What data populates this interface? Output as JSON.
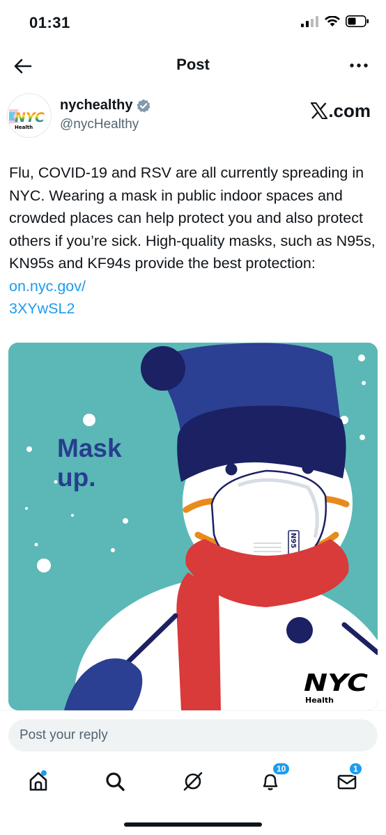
{
  "status": {
    "time": "01:31"
  },
  "nav": {
    "title": "Post"
  },
  "author": {
    "display_name": "nychealthy",
    "handle": "@nycHealthy",
    "source": ".com",
    "avatar_text": "NYC",
    "avatar_sub": "Health"
  },
  "post": {
    "text": "Flu, COVID-19 and RSV are all currently spreading in NYC. Wearing a mask in public indoor spaces and crowded places can help protect you and also protect others if you’re sick. High-quality masks, such as N95s, KN95s and KF94s provide the best protection: ",
    "link_line1": "on.nyc.gov/",
    "link_line2": "3XYwSL2"
  },
  "media": {
    "headline_line1": "Mask",
    "headline_line2": "up.",
    "mask_label": "N95",
    "logo_text": "NYC",
    "logo_sub": "Health",
    "colors": {
      "background": "#5bb8b6",
      "hat": "#2b3f93",
      "hat_band": "#1b2163",
      "scarf": "#d93a3a",
      "strap": "#e98a1c",
      "text": "#273e8e"
    }
  },
  "reply": {
    "placeholder": "Post your reply"
  },
  "tabs": [
    {
      "name": "home",
      "dot": true
    },
    {
      "name": "search"
    },
    {
      "name": "grok"
    },
    {
      "name": "notifications",
      "badge": "10"
    },
    {
      "name": "messages",
      "badge": "1"
    }
  ],
  "accent": "#1d9bf0"
}
